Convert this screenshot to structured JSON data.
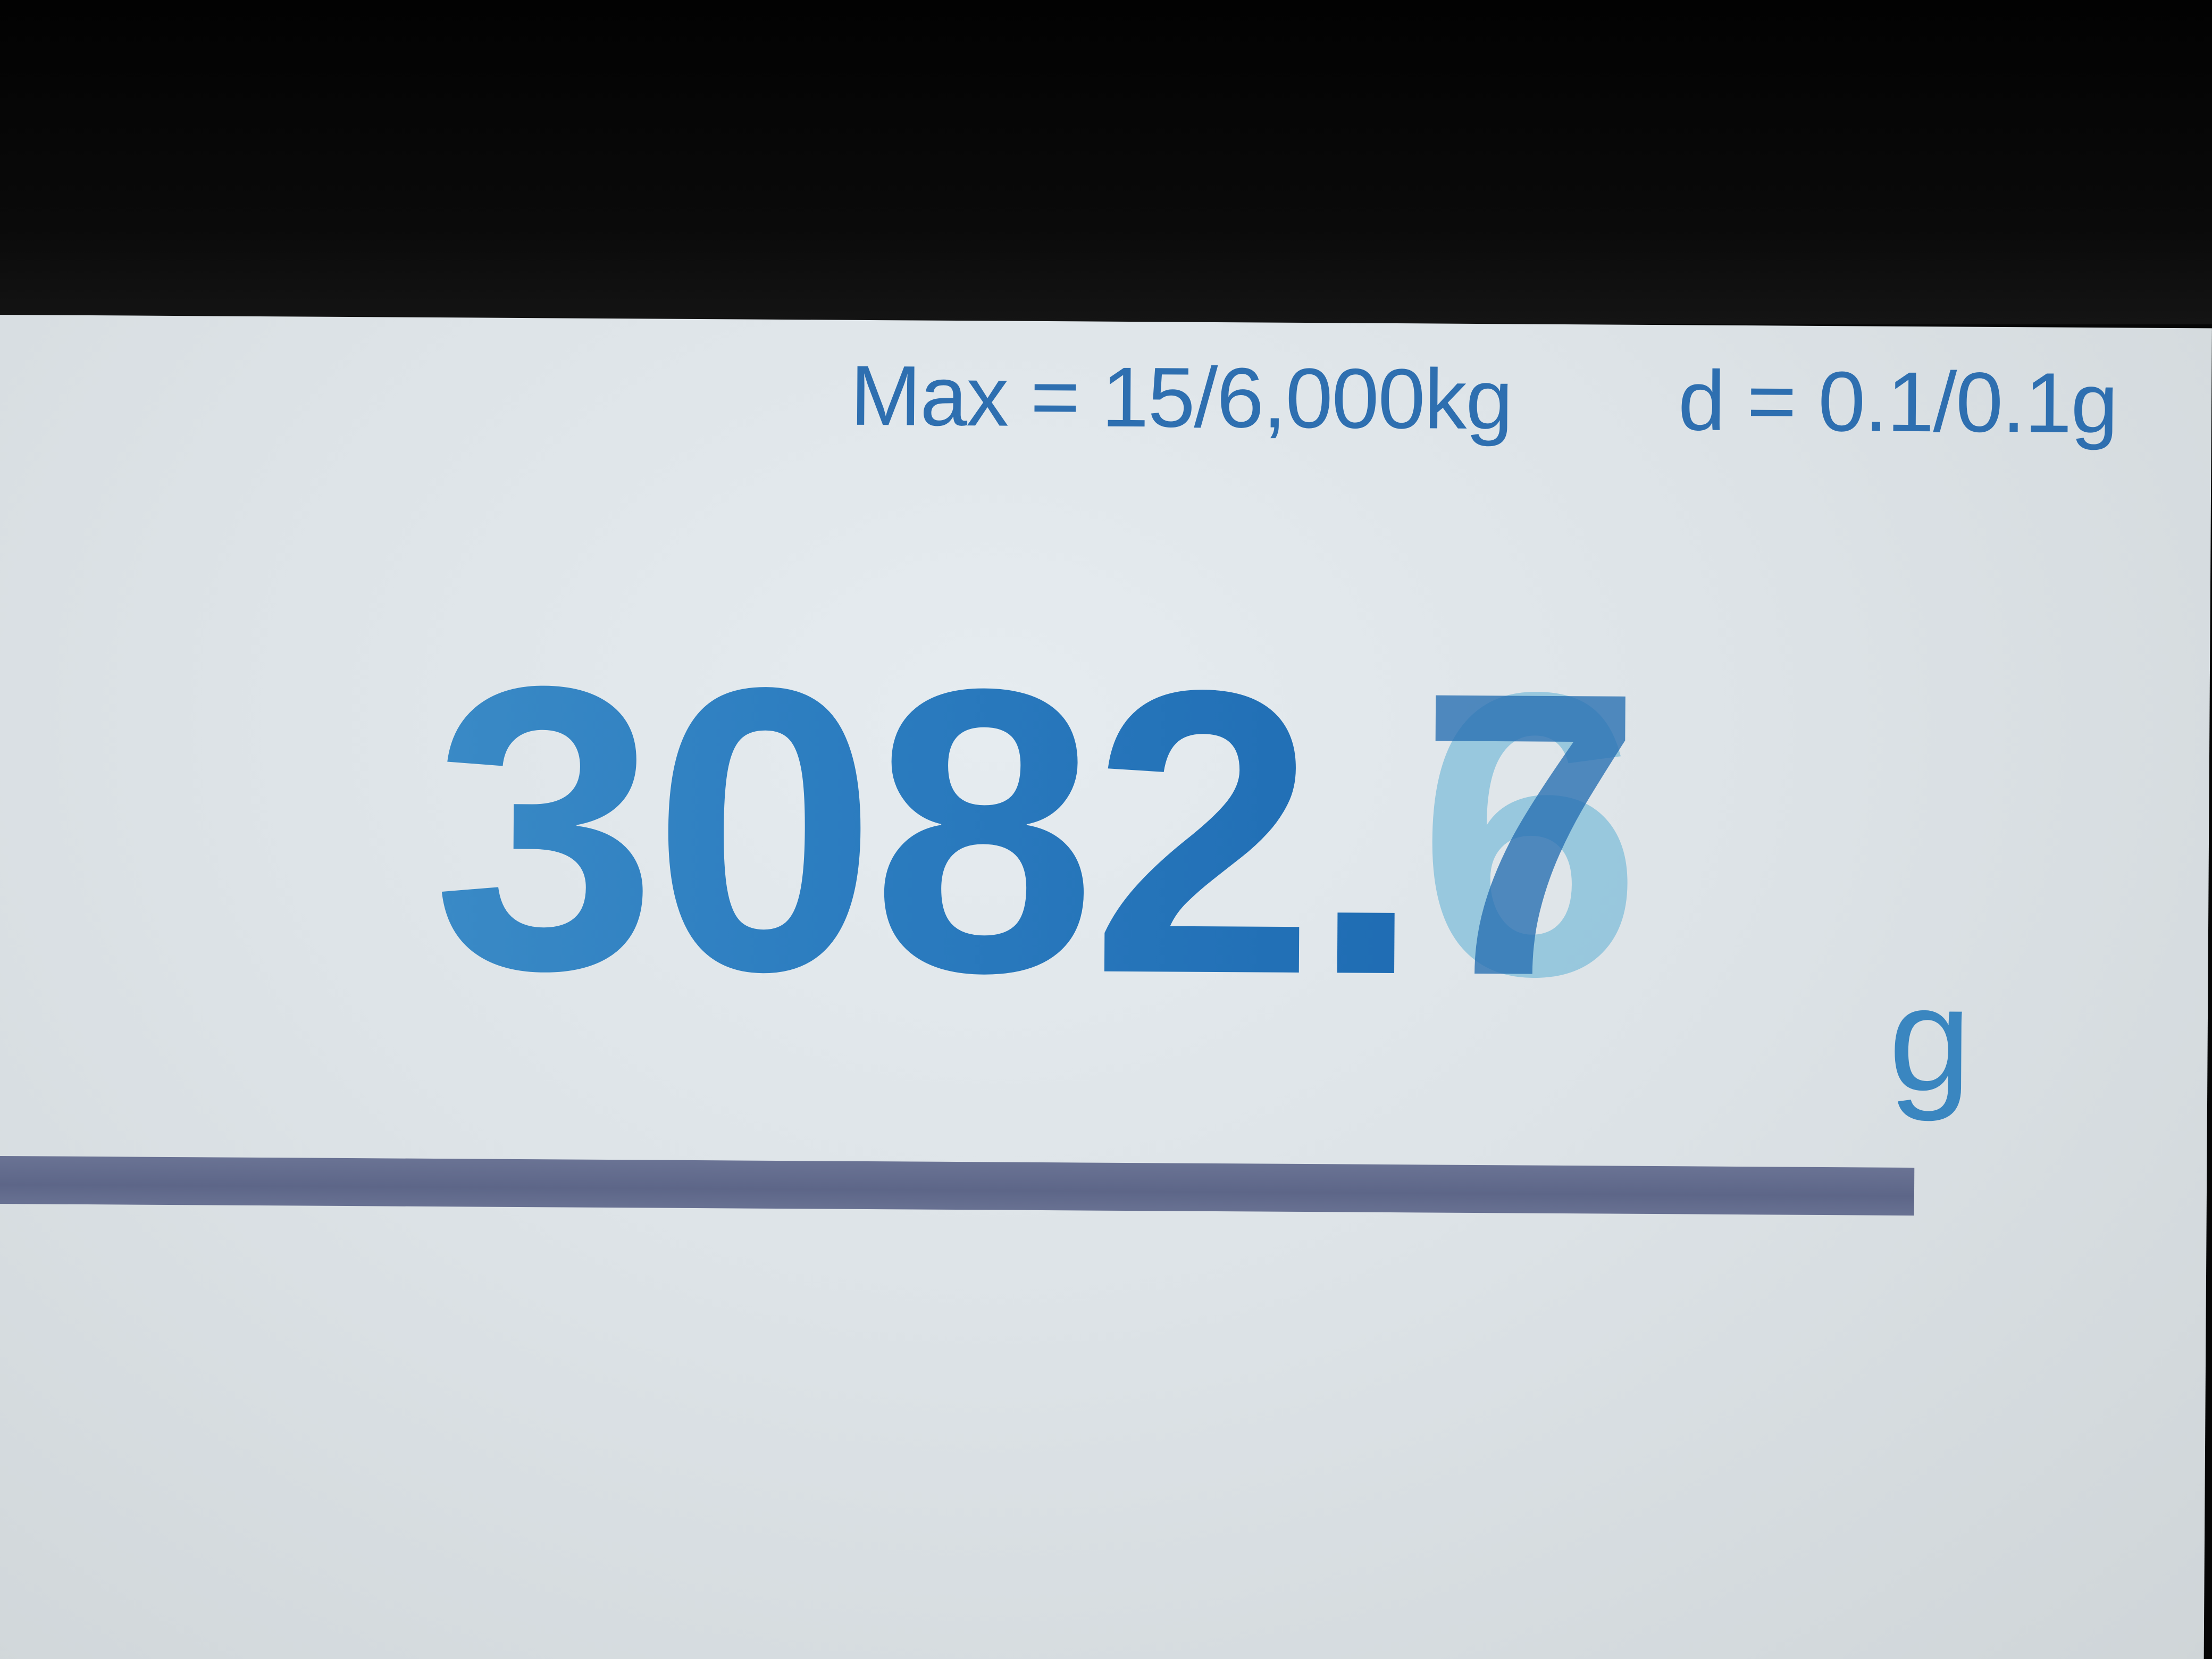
{
  "scale_display": {
    "max_label": "Max = 15/6,000kg",
    "d_label": "d = 0.1/0.1g",
    "reading_integer": "3082.",
    "reading_last_digit_prev": "6",
    "reading_last_digit_next": "7",
    "unit": "g",
    "load_bar_fraction": 1.0
  },
  "colors": {
    "digit_blue": "#2c7dc0",
    "ghost_light_blue": "#8cc3dc",
    "label_blue": "#2e6fb0",
    "bar_gray_blue": "#5d6688",
    "screen_bg": "#e0e6ea"
  }
}
